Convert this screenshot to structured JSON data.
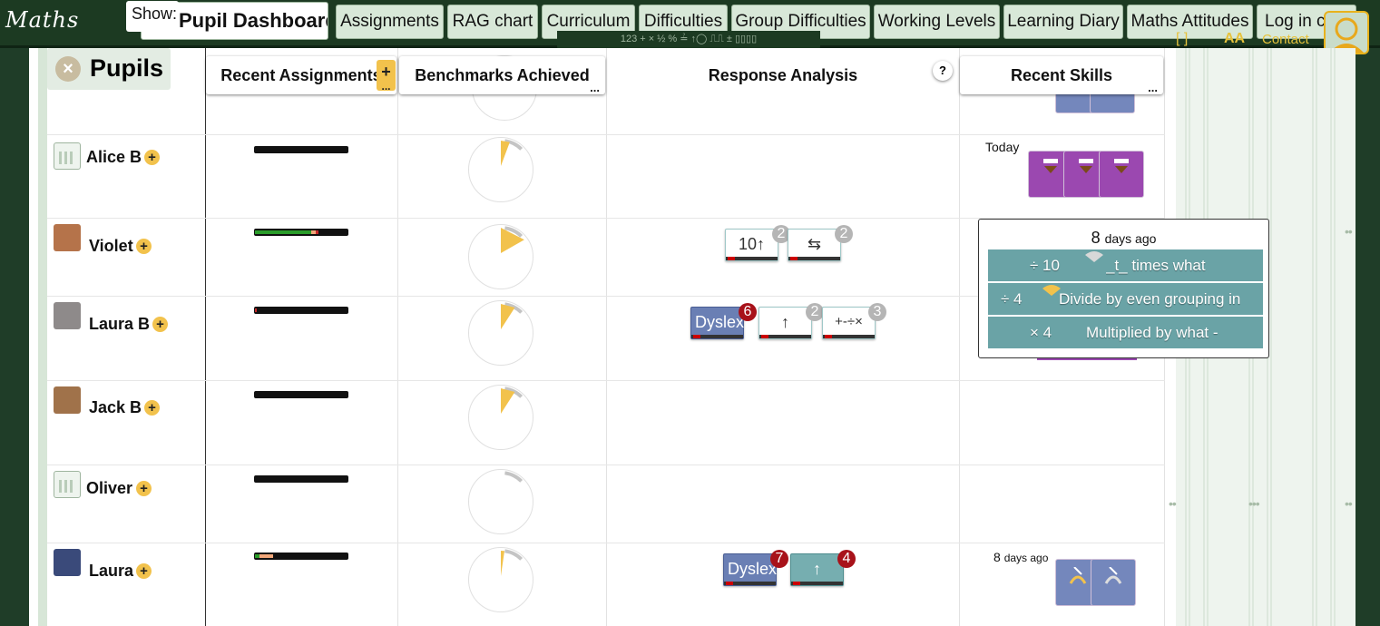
{
  "logo": {
    "text": "Maths"
  },
  "header": {
    "show_label": "Show:",
    "tabs": [
      {
        "label": "Pupil Dashboard",
        "active": true
      },
      {
        "label": "Assignments"
      },
      {
        "label": "RAG chart"
      },
      {
        "label": "Curriculum"
      },
      {
        "label": "Difficulties"
      },
      {
        "label": "Group Difficulties"
      },
      {
        "label": "Working Levels"
      },
      {
        "label": "Learning Diary"
      },
      {
        "label": "Maths Attitudes"
      },
      {
        "label": "Log in c"
      }
    ],
    "toolbar_hint": "123  +  ×  ½ %  ≟  ↑◯ ⎍⎍ ±  ▯▯▯▯",
    "aa_label": "AA",
    "contact_label": "Contact",
    "bracket_glyph": "[ ]"
  },
  "pupils_panel": {
    "title": "Pupils",
    "close_glyph": "×"
  },
  "columns": {
    "recent_assignments": "Recent Assignments",
    "benchmarks": "Benchmarks Achieved",
    "response_analysis": "Response Analysis",
    "recent_skills": "Recent Skills",
    "more_glyph": "...",
    "add_glyph": "+",
    "help_glyph": "?"
  },
  "pupils": [
    {
      "name": "Alice B",
      "avatar": "chart-avatar",
      "progress": {
        "green": 0,
        "orange": 0,
        "red": 0
      },
      "benchmark_fraction": 0.05
    },
    {
      "name": "Violet",
      "avatar": "girl-avatar",
      "progress": {
        "green": 0.6,
        "orange": 0.05,
        "red": 0.03
      },
      "benchmark_fraction": 0.15
    },
    {
      "name": "Laura B",
      "avatar": "rabbit-avatar",
      "progress": {
        "green": 0,
        "orange": 0,
        "red": 0.02
      },
      "benchmark_fraction": 0.08
    },
    {
      "name": "Jack B",
      "avatar": "dog-avatar",
      "progress": {
        "green": 0,
        "orange": 0,
        "red": 0
      },
      "benchmark_fraction": 0.08
    },
    {
      "name": "Oliver",
      "avatar": "chart-avatar",
      "progress": {
        "green": 0,
        "orange": 0,
        "red": 0
      },
      "benchmark_fraction": 0
    },
    {
      "name": "Laura",
      "avatar": "husky-avatar",
      "progress": {
        "green": 0.05,
        "orange": 0.14,
        "red": 0
      },
      "benchmark_fraction": 0.02
    }
  ],
  "response_chips": {
    "violet": [
      {
        "label": "10↑",
        "count": "2"
      },
      {
        "label": "⇆",
        "count": "2"
      }
    ],
    "laura_b": [
      {
        "label": "Dyslex",
        "count": "6"
      },
      {
        "label": "↑",
        "count": "2"
      },
      {
        "label": "+-÷×",
        "count": "3"
      }
    ],
    "laura": [
      {
        "label": "Dyslex",
        "count": "7"
      },
      {
        "label": "↑",
        "count": "4"
      }
    ]
  },
  "skills": {
    "alice_when": "Today",
    "laura_when_num": "8",
    "laura_when_unit": "days ago"
  },
  "popup": {
    "ago_num": "8",
    "ago_unit": "days ago",
    "rows": [
      {
        "op": "÷ 10",
        "desc": "_t_ times what"
      },
      {
        "op": "÷ 4",
        "desc": "Divide by even grouping in"
      },
      {
        "op": "× 4",
        "desc": "Multiplied by what -"
      }
    ]
  },
  "colors": {
    "accent": "#f2c24c",
    "header_bg": "#1c3a22",
    "purple_skill": "#9b48b0",
    "blue_skill": "#7487bc",
    "teal": "#6aa3a6",
    "badge_red": "#a8121a"
  }
}
